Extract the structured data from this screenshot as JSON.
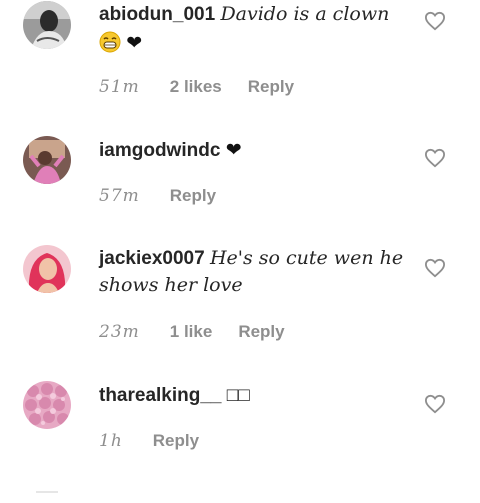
{
  "comments": [
    {
      "username": "abiodun_001",
      "text": "Davido is a clown",
      "second_line": "❤",
      "time": "51m",
      "likes": "2 likes",
      "reply": "Reply"
    },
    {
      "username": "iamgodwindc",
      "text": "❤",
      "time": "57m",
      "reply": "Reply"
    },
    {
      "username": "jackiex0007",
      "text": "He's so cute wen he",
      "second_line": "shows her love",
      "time": "23m",
      "likes": "1 like",
      "reply": "Reply"
    },
    {
      "username": "tharealking__",
      "text": "□□",
      "time": "1h",
      "reply": "Reply"
    }
  ],
  "icons": {
    "like": "heart-outline-icon",
    "grin_emoji": "grinning-face-emoji"
  },
  "colors": {
    "text": "#262626",
    "meta": "#8e8e8e"
  }
}
